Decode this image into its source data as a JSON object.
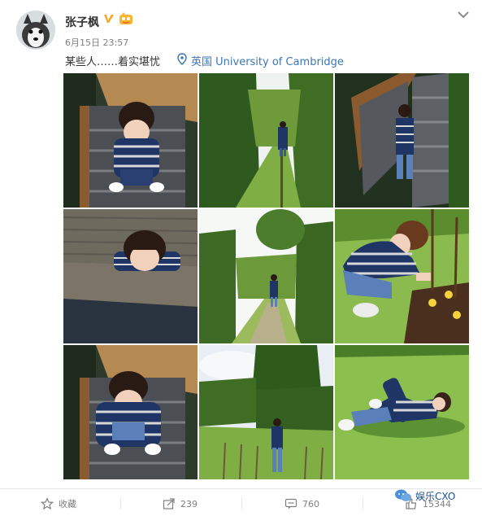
{
  "post": {
    "username": "张子枫",
    "timestamp": "6月15日 23:57",
    "text": "某些人……着实堪忧",
    "location": "英国 University of Cambridge"
  },
  "footer": {
    "favorite_label": "收藏",
    "repost_count": "239",
    "comment_count": "760",
    "like_count": "15344"
  },
  "watermark": {
    "text": "娱乐CXO"
  },
  "colors": {
    "link": "#3e76b3",
    "verified_badge": "#f5a623",
    "text": "#333333",
    "muted": "#808080"
  }
}
